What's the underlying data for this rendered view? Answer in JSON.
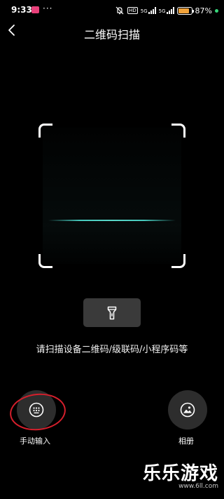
{
  "status_bar": {
    "time": "9:33",
    "dots": "···",
    "hd_label": "HD",
    "net1_label": "5G",
    "net2_label": "5G",
    "battery_percent": 87,
    "battery_text": "87%"
  },
  "header": {
    "title": "二维码扫描",
    "back_icon": "chevron-left-icon"
  },
  "scanner": {
    "flashlight_icon": "flashlight-icon",
    "hint": "请扫描设备二维码/级联码/小程序码等"
  },
  "actions": {
    "manual_input_label": "手动输入",
    "manual_input_icon": "keypad-icon",
    "album_label": "相册",
    "album_icon": "image-icon"
  },
  "watermark": {
    "brand": "乐乐游戏",
    "url": "www.6ll.com"
  },
  "colors": {
    "background": "#000000",
    "scan_line": "#46c8bc",
    "annotation": "#d51f2c",
    "battery": "#f2a33a"
  }
}
